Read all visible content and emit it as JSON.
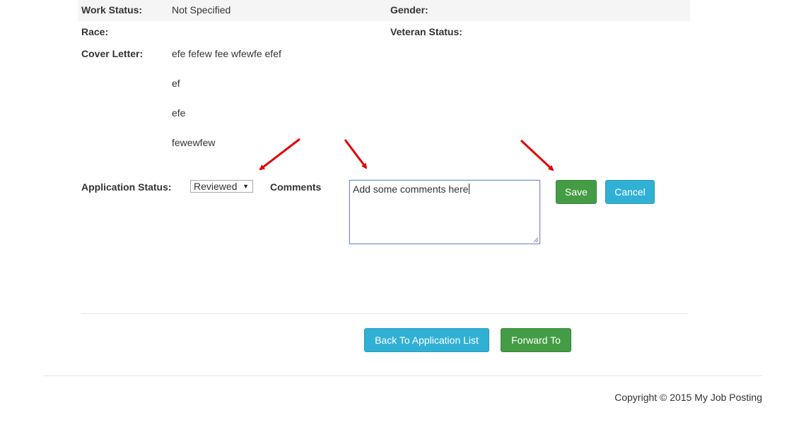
{
  "details": {
    "work_status_label": "Work Status:",
    "work_status_value": "Not Specified",
    "gender_label": "Gender:",
    "race_label": "Race:",
    "veteran_label": "Veteran Status:",
    "cover_letter_label": "Cover Letter:",
    "cover_letter_lines": [
      "efe fefew fee wfewfe efef",
      "ef",
      "efe",
      "fewewfew"
    ]
  },
  "application": {
    "status_label": "Application Status:",
    "status_selected": "Reviewed",
    "comments_label": "Comments",
    "comments_text": "Add some comments here",
    "save_label": "Save",
    "cancel_label": "Cancel"
  },
  "actions": {
    "back_label": "Back To Application List",
    "forward_label": "Forward To"
  },
  "footer": {
    "copyright": "Copyright © 2015 My Job Posting"
  },
  "colors": {
    "green_button": "#449d44",
    "blue_button": "#31b0d5",
    "annotation_arrow": "#e60000",
    "focus_border": "#6f8fd9"
  }
}
